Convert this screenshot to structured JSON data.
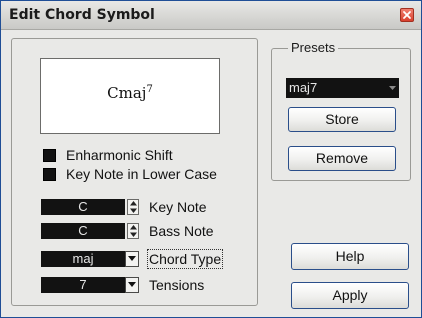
{
  "window": {
    "title": "Edit Chord Symbol"
  },
  "preview": {
    "chord_root": "Cmaj",
    "chord_superscript": "7"
  },
  "options": {
    "enharmonic_shift_label": "Enharmonic Shift",
    "enharmonic_shift_checked": false,
    "lowercase_label": "Key Note in Lower Case",
    "lowercase_checked": false
  },
  "fields": {
    "key_note": {
      "value": "C",
      "label": "Key Note"
    },
    "bass_note": {
      "value": "C",
      "label": "Bass Note"
    },
    "chord_type": {
      "value": "maj",
      "label": "Chord Type"
    },
    "tensions": {
      "value": "7",
      "label": "Tensions"
    }
  },
  "presets": {
    "legend": "Presets",
    "selected": "maj7",
    "store_label": "Store",
    "remove_label": "Remove"
  },
  "buttons": {
    "help_label": "Help",
    "apply_label": "Apply"
  },
  "icons": {
    "close": "close-icon",
    "spinner": "up-down-arrows-icon",
    "dropdown": "chevron-down-icon"
  },
  "colors": {
    "title_border": "#1f4e96",
    "field_bg": "#121212",
    "close_red": "#d9402e"
  }
}
